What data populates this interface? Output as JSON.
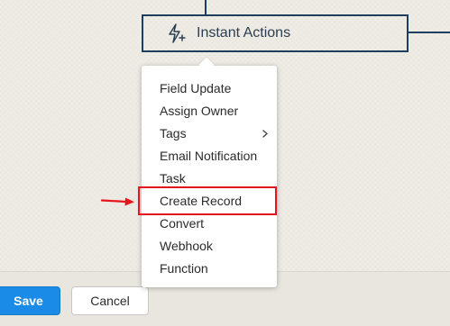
{
  "node": {
    "label": "Instant Actions",
    "icon": "lightning-plus-icon"
  },
  "menu": {
    "items": [
      {
        "label": "Field Update"
      },
      {
        "label": "Assign Owner"
      },
      {
        "label": "Tags",
        "has_submenu": true
      },
      {
        "label": "Email Notification"
      },
      {
        "label": "Task"
      },
      {
        "label": "Create Record",
        "highlighted": true
      },
      {
        "label": "Convert"
      },
      {
        "label": "Webhook"
      },
      {
        "label": "Function"
      }
    ],
    "submenu_icon": "chevron-right-icon"
  },
  "annotation": {
    "color": "#e8141b"
  },
  "footer": {
    "save_label": "Save",
    "cancel_label": "Cancel"
  },
  "colors": {
    "connector": "#1f3d5e",
    "primary_button": "#1a8be6",
    "background": "#f0ede6"
  }
}
